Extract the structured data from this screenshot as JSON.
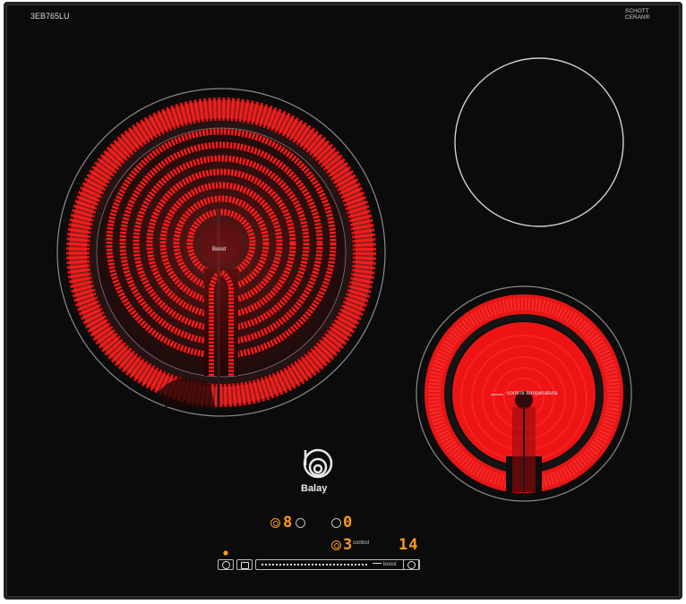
{
  "model": "3EB765LU",
  "glass_brand": {
    "line1": "SCHOTT",
    "line2": "CERAN®"
  },
  "brand": "Balay",
  "zones": {
    "left": {
      "label": "Boost"
    },
    "bottom_right": {
      "label": "control temperatura"
    }
  },
  "controls": {
    "zone1_level": "8",
    "zone2_level": "0",
    "zone3_level": "3",
    "zone3_label": "control",
    "timer_display": "14",
    "boost_label": "boost"
  },
  "colors": {
    "glass": "#0b0b0b",
    "heat": "#ff1414",
    "display": "#ff9a1a"
  }
}
